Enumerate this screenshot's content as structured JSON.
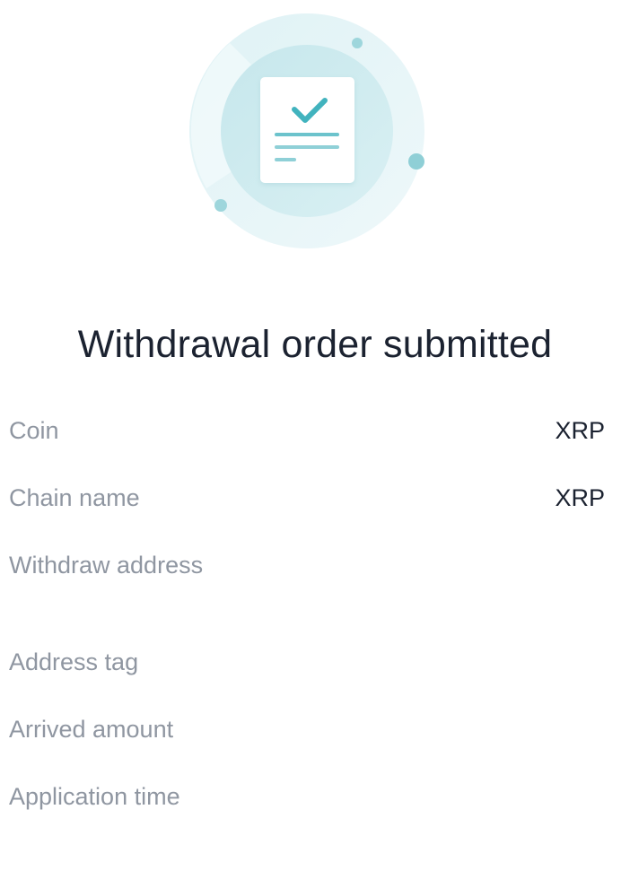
{
  "header": {
    "illustration_icon": "document-check-icon",
    "title": "Withdrawal order submitted"
  },
  "details": [
    {
      "label": "Coin",
      "value": "XRP"
    },
    {
      "label": "Chain name",
      "value": "XRP"
    },
    {
      "label": "Withdraw address",
      "value": ""
    },
    {
      "label": "Address tag",
      "value": ""
    },
    {
      "label": "Arrived amount",
      "value": ""
    },
    {
      "label": "Application time",
      "value": ""
    }
  ],
  "colors": {
    "accent": "#41b3be",
    "ring_light": "#e9f6f8",
    "ring_mid": "#d4eef2",
    "title_text": "#1b2230",
    "label_text": "#8f96a1"
  }
}
